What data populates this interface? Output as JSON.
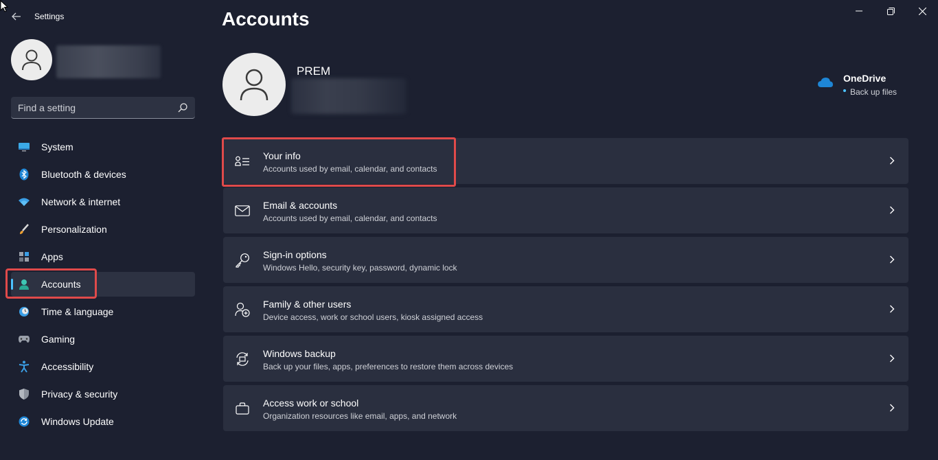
{
  "window": {
    "title": "Settings",
    "back_icon": "back-arrow-icon",
    "minimize_icon": "minimize-icon",
    "maximize_icon": "maximize-icon",
    "close_icon": "close-icon"
  },
  "sidebar": {
    "profile_avatar_icon": "person-icon",
    "search": {
      "placeholder": "Find a setting",
      "value": "",
      "icon": "search-icon"
    },
    "items": [
      {
        "label": "System",
        "icon": "monitor-icon",
        "active": false
      },
      {
        "label": "Bluetooth & devices",
        "icon": "bluetooth-icon",
        "active": false
      },
      {
        "label": "Network & internet",
        "icon": "wifi-icon",
        "active": false
      },
      {
        "label": "Personalization",
        "icon": "paintbrush-icon",
        "active": false
      },
      {
        "label": "Apps",
        "icon": "apps-grid-icon",
        "active": false
      },
      {
        "label": "Accounts",
        "icon": "person-icon",
        "active": true
      },
      {
        "label": "Time & language",
        "icon": "clock-globe-icon",
        "active": false
      },
      {
        "label": "Gaming",
        "icon": "gamepad-icon",
        "active": false
      },
      {
        "label": "Accessibility",
        "icon": "accessibility-icon",
        "active": false
      },
      {
        "label": "Privacy & security",
        "icon": "shield-icon",
        "active": false
      },
      {
        "label": "Windows Update",
        "icon": "update-sync-icon",
        "active": false
      }
    ]
  },
  "main": {
    "title": "Accounts",
    "user": {
      "name": "PREM",
      "avatar_icon": "person-icon"
    },
    "onedrive": {
      "title": "OneDrive",
      "subtitle": "Back up files",
      "icon": "cloud-icon"
    },
    "cards": [
      {
        "title": "Your info",
        "subtitle": "Accounts used by email, calendar, and contacts",
        "icon": "contact-card-icon"
      },
      {
        "title": "Email & accounts",
        "subtitle": "Accounts used by email, calendar, and contacts",
        "icon": "mail-icon"
      },
      {
        "title": "Sign-in options",
        "subtitle": "Windows Hello, security key, password, dynamic lock",
        "icon": "key-icon"
      },
      {
        "title": "Family & other users",
        "subtitle": "Device access, work or school users, kiosk assigned access",
        "icon": "person-add-icon"
      },
      {
        "title": "Windows backup",
        "subtitle": "Back up your files, apps, preferences to restore them across devices",
        "icon": "backup-sync-icon"
      },
      {
        "title": "Access work or school",
        "subtitle": "Organization resources like email, apps, and network",
        "icon": "briefcase-icon"
      }
    ]
  },
  "colors": {
    "background": "#1c2030",
    "card": "#2a2f3f",
    "accent": "#4cc2ff",
    "highlight": "#e04a4a"
  }
}
